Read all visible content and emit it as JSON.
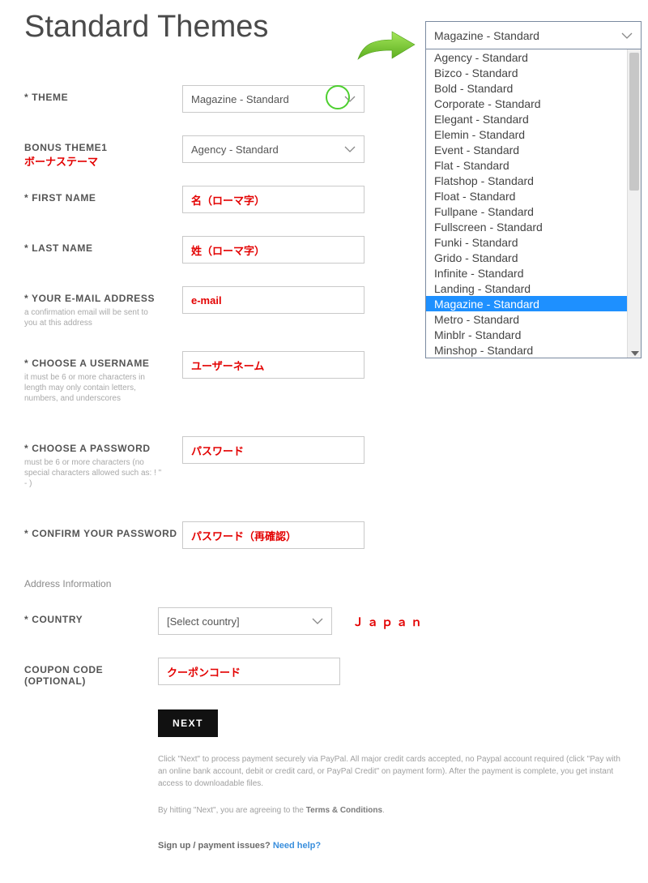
{
  "page": {
    "title": "Standard Themes"
  },
  "form": {
    "theme": {
      "label": "* THEME",
      "value": "Magazine - Standard"
    },
    "bonus_theme": {
      "label": "BONUS THEME1",
      "value": "Agency - Standard",
      "red_annot": "ボーナステーマ"
    },
    "first_name": {
      "label": "* FIRST NAME",
      "overlay": "名（ローマ字）"
    },
    "last_name": {
      "label": "* LAST NAME",
      "overlay": "姓（ローマ字）"
    },
    "email": {
      "label": "* YOUR E-MAIL ADDRESS",
      "hint": "a confirmation email will be sent to you at this address",
      "overlay": "e-mail"
    },
    "username": {
      "label": "* CHOOSE A USERNAME",
      "hint": "it must be 6 or more characters in length may only contain letters, numbers, and underscores",
      "overlay": "ユーザーネーム"
    },
    "password": {
      "label": "* CHOOSE A PASSWORD",
      "hint": "must be 6 or more characters (no special characters allowed such as: ! \" - )",
      "overlay": "パスワード"
    },
    "confirm_pw": {
      "label": "* CONFIRM YOUR PASSWORD",
      "overlay": "パスワード（再確認）"
    },
    "address_section": "Address Information",
    "country": {
      "label": "* COUNTRY",
      "value": "[Select country]",
      "right_annot": "Ｊａｐａｎ"
    },
    "coupon": {
      "label": "COUPON CODE (OPTIONAL)",
      "overlay": "クーポンコード"
    },
    "next": "NEXT",
    "fine1": "Click \"Next\" to process payment securely via PayPal. All major credit cards accepted, no Paypal account required (click \"Pay with an online bank account, debit or credit card, or PayPal Credit\" on payment form). After the payment is complete, you get instant access to downloadable files.",
    "fine2a": "By hitting \"Next\", you are agreeing to the ",
    "fine2b": "Terms & Conditions",
    "fine2c": ".",
    "signup_a": "Sign up / payment issues? ",
    "signup_b": "Need help?"
  },
  "popup": {
    "head": "Magazine - Standard",
    "selected": "Magazine - Standard",
    "opts": [
      "Agency - Standard",
      "Bizco - Standard",
      "Bold - Standard",
      "Corporate - Standard",
      "Elegant - Standard",
      "Elemin - Standard",
      "Event - Standard",
      "Flat - Standard",
      "Flatshop - Standard",
      "Float - Standard",
      "Fullpane - Standard",
      "Fullscreen - Standard",
      "Funki - Standard",
      "Grido - Standard",
      "Infinite - Standard",
      "Landing - Standard",
      "Magazine - Standard",
      "Metro - Standard",
      "Minblr - Standard",
      "Minshop - Standard"
    ]
  }
}
